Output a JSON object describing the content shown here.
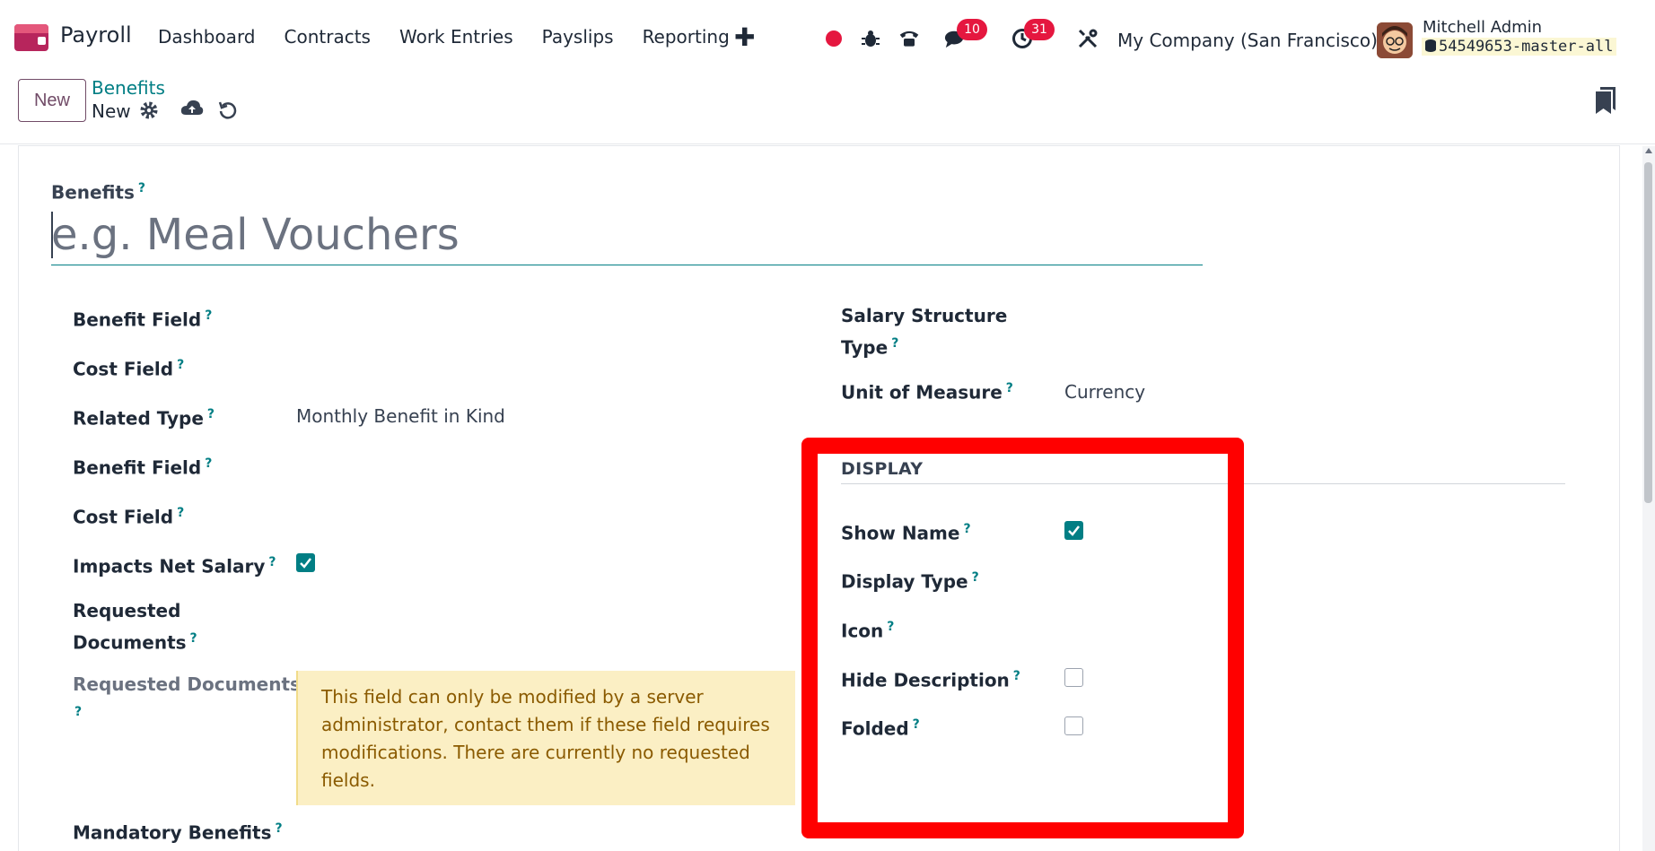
{
  "app": {
    "name": "Payroll"
  },
  "menu": [
    "Dashboard",
    "Contracts",
    "Work Entries",
    "Payslips",
    "Reporting"
  ],
  "systray": {
    "chat_count": "10",
    "activity_count": "31",
    "company": "My Company (San Francisco)"
  },
  "user": {
    "name": "Mitchell Admin",
    "database": "54549653-master-all"
  },
  "control": {
    "new_label": "New",
    "breadcrumb_parent": "Benefits",
    "breadcrumb_current": "New"
  },
  "form": {
    "title_label": "Benefits",
    "title_placeholder": "e.g. Meal Vouchers",
    "help_mark": "?",
    "left": {
      "benefit_field_1": "Benefit Field",
      "cost_field_1": "Cost Field",
      "related_type_label": "Related Type",
      "related_type_value": "Monthly Benefit in Kind",
      "benefit_field_2": "Benefit Field",
      "cost_field_2": "Cost Field",
      "impacts_net_salary": "Impacts Net Salary",
      "impacts_net_salary_checked": true,
      "requested_documents_line1": "Requested",
      "requested_documents_line2": "Documents",
      "requested_documents_readonly": "Requested Documents",
      "alert": "This field can only be modified by a server administrator, contact them if these field requires modifications. There are currently no requested fields.",
      "mandatory_benefits": "Mandatory Benefits"
    },
    "right": {
      "salary_structure_line1": "Salary Structure",
      "salary_structure_line2": "Type",
      "unit_of_measure_label": "Unit of Measure",
      "unit_of_measure_value": "Currency",
      "display_section": "DISPLAY",
      "show_name": "Show Name",
      "show_name_checked": true,
      "display_type": "Display Type",
      "icon": "Icon",
      "hide_description": "Hide Description",
      "hide_description_checked": false,
      "folded": "Folded",
      "folded_checked": false
    }
  },
  "colors": {
    "accent": "#017e84",
    "brand": "#714b67",
    "badge": "#e5173f",
    "highlight": "#ff0000"
  }
}
